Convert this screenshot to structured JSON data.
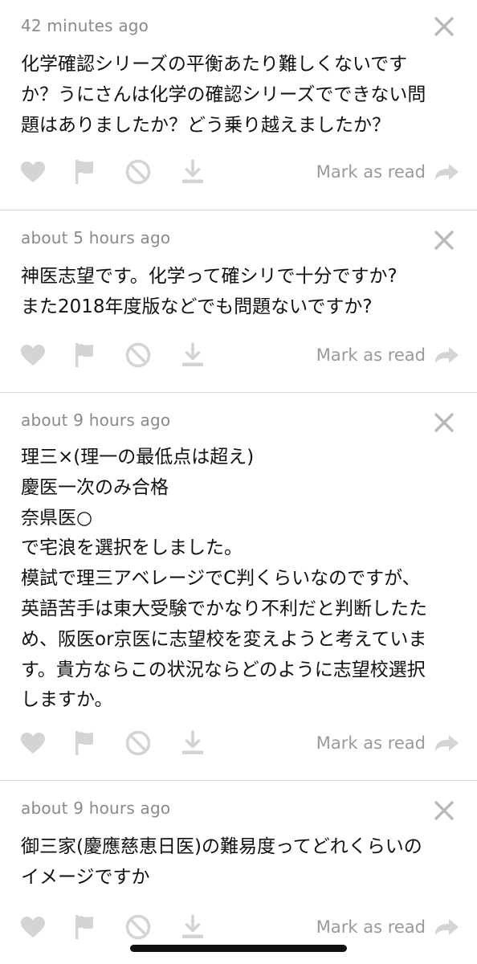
{
  "messages": [
    {
      "time": "42 minutes ago",
      "text": "化学確認シリーズの平衡あたり難しくないです\nか？うにさんは化学の確認シリーズでできない問\n題はありましたか？どう乗り越えましたか？"
    },
    {
      "time": "about 5 hours ago",
      "text": "神医志望です。化学って確シリで十分ですか?\nまた2018年度版などでも問題ないですか?"
    },
    {
      "time": "about 9 hours ago",
      "text": "理三×(理一の最低点は超え)\n慶医一次のみ合格\n奈県医○\nで宅浪を選択をしました。\n模試で理三アベレージでC判くらいなのですが、\n英語苦手は東大受験でかなり不利だと判断したた\nめ、阪医or京医に志望校を変えようと考えていま\nす。貴方ならこの状況ならどのように志望校選択\nしますか。"
    },
    {
      "time": "about 9 hours ago",
      "text": "御三家(慶應慈恵日医)の難易度ってどれくらいの\nイメージですか"
    }
  ],
  "actions": {
    "mark_as_read": "Mark as read"
  },
  "icons": {
    "like": "heart-icon",
    "report": "flag-icon",
    "block": "block-icon",
    "download": "download-icon",
    "close": "close-icon",
    "forward": "forward-arrow-icon"
  },
  "colors": {
    "icon_gray": "#d4d4d4",
    "timestamp_gray": "#8a8a8a",
    "text": "#111111",
    "divider": "#d9d9d9",
    "home_indicator": "#111111"
  }
}
